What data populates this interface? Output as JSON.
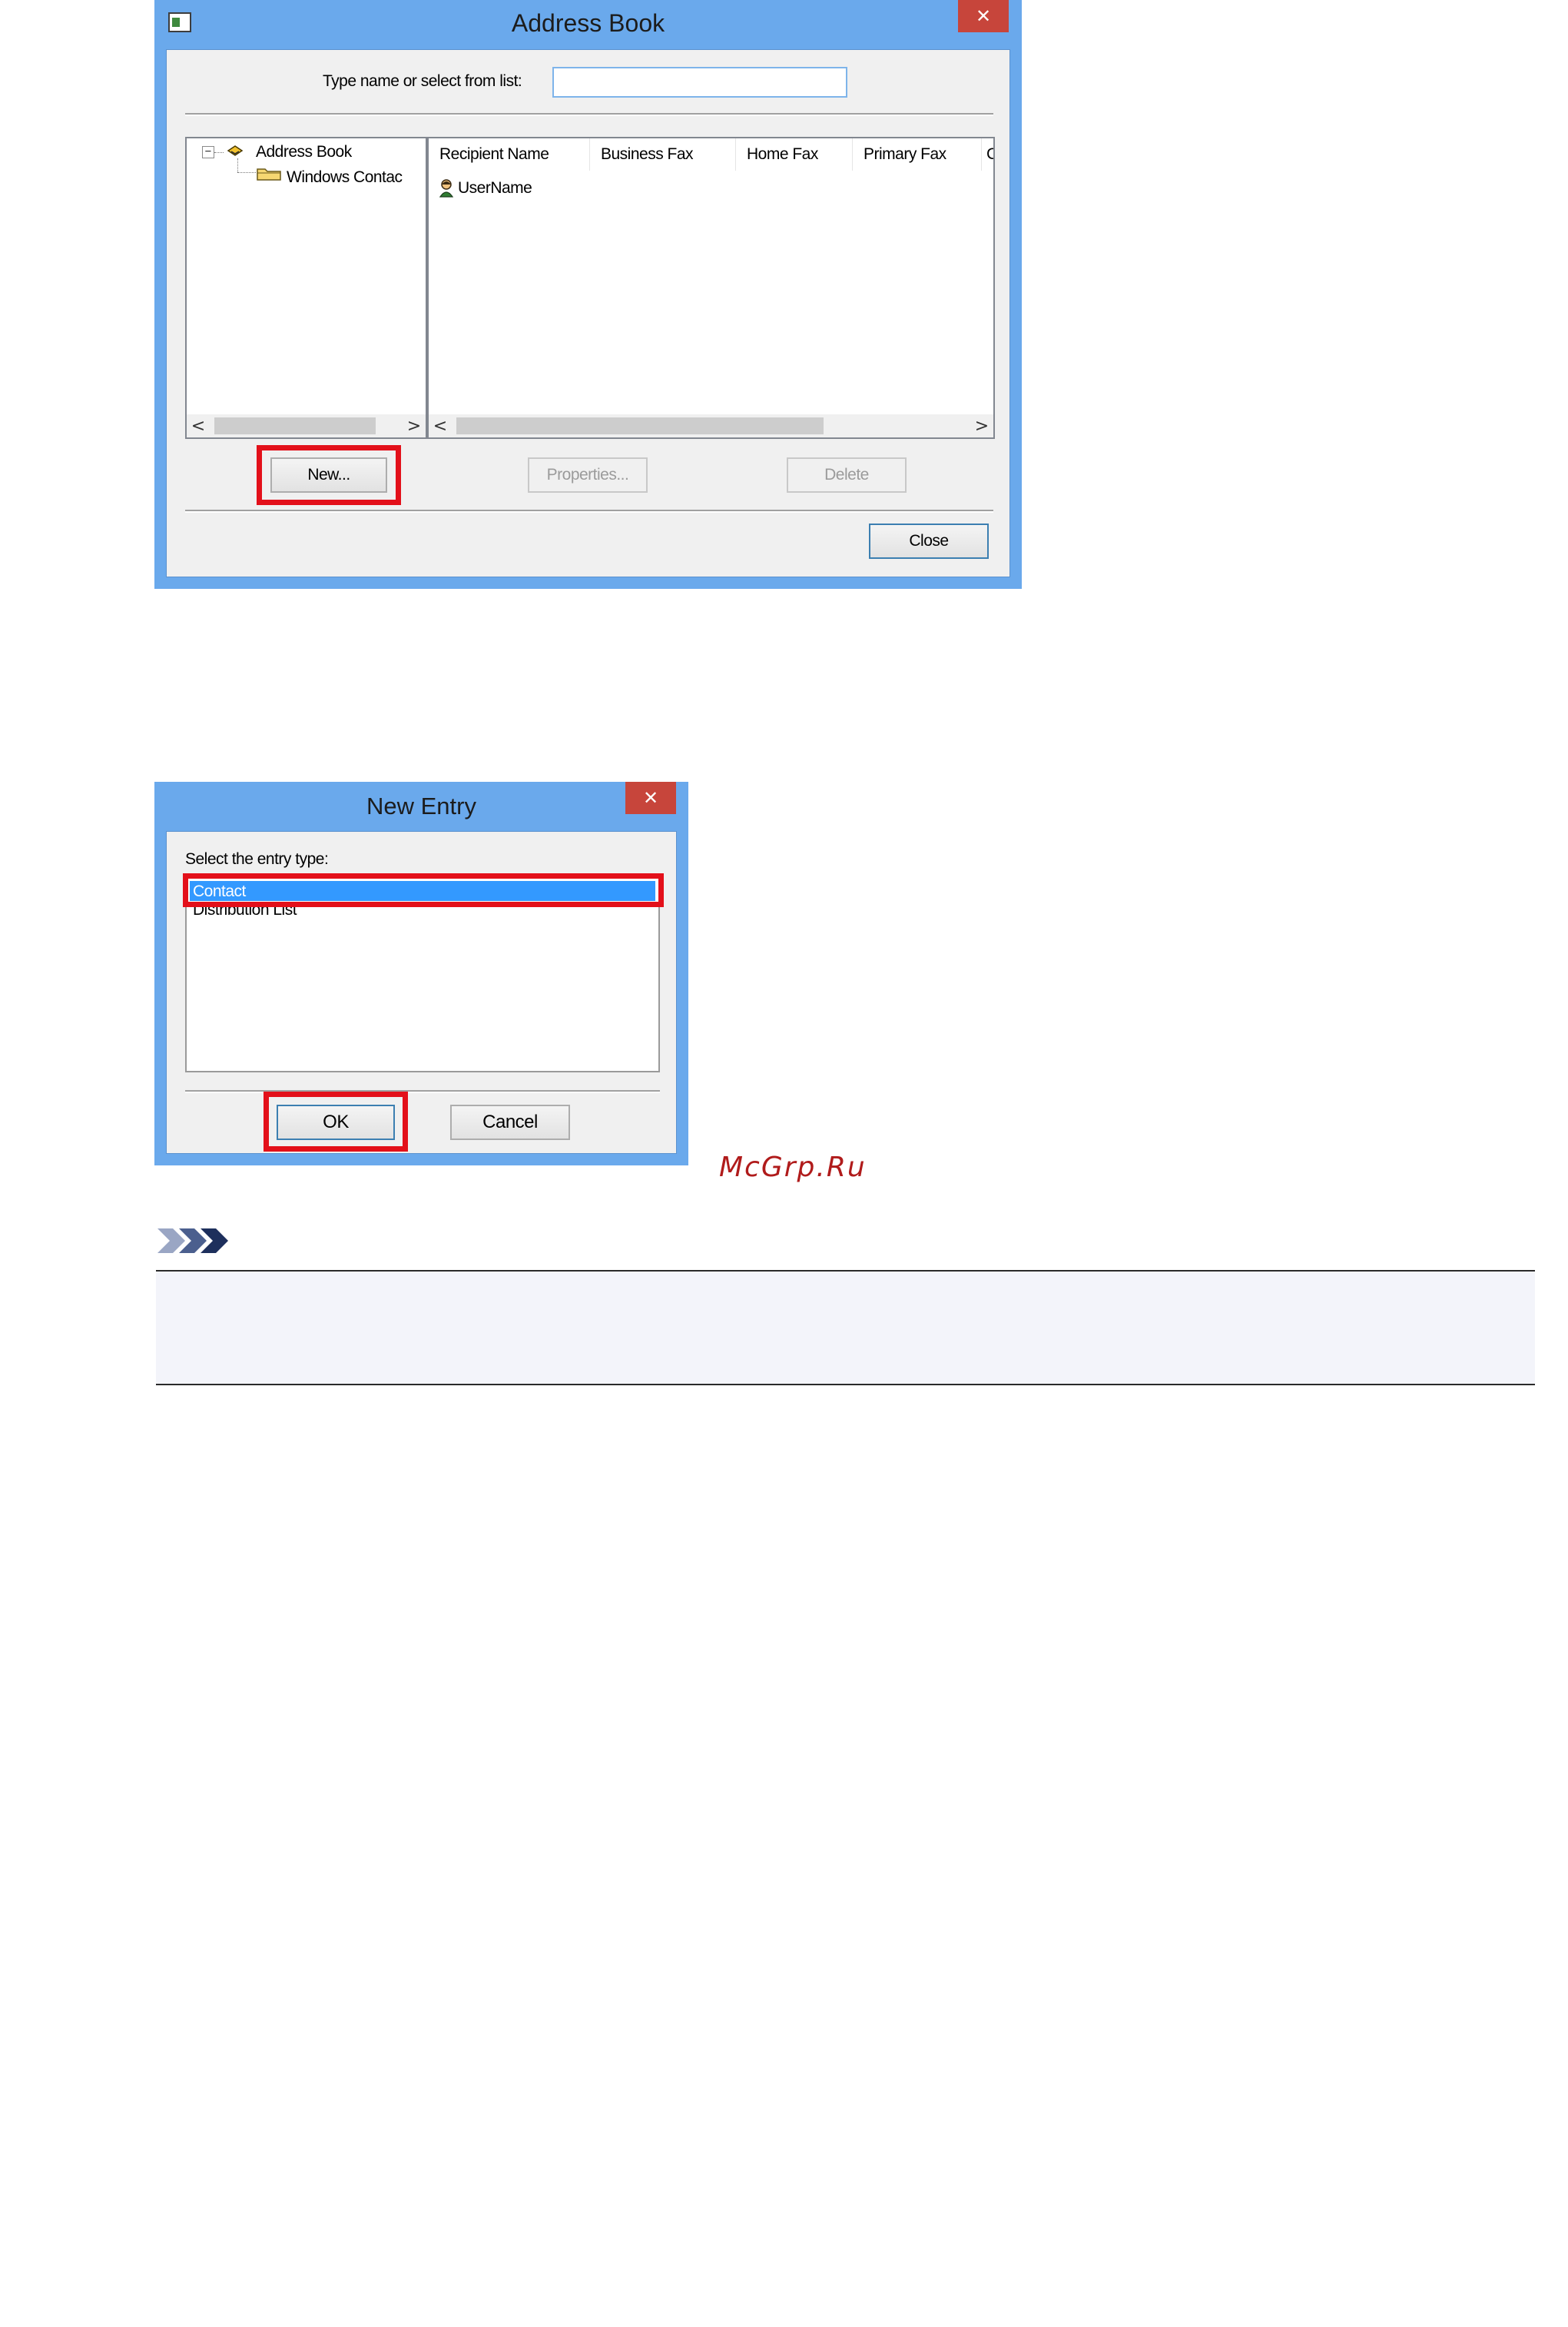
{
  "address_book": {
    "title": "Address Book",
    "close_x": "✕",
    "type_label": "Type name or select from list:",
    "input_value": "",
    "tree": {
      "root_label": "Address Book",
      "child_label": "Windows Contac"
    },
    "columns": [
      "Recipient Name",
      "Business Fax",
      "Home Fax",
      "Primary Fax",
      "C"
    ],
    "rows": [
      {
        "name": "UserName"
      }
    ],
    "buttons": {
      "new": "New...",
      "properties": "Properties...",
      "delete": "Delete",
      "close": "Close"
    },
    "scroll_left": "<",
    "scroll_right": ">"
  },
  "new_entry": {
    "title": "New Entry",
    "close_x": "✕",
    "prompt": "Select the entry type:",
    "items": [
      "Contact",
      "Distribution List"
    ],
    "selected_index": 0,
    "buttons": {
      "ok": "OK",
      "cancel": "Cancel"
    }
  },
  "watermark": "McGrp.Ru",
  "colors": {
    "titlebar": "#6aa9ec",
    "close": "#c7453b",
    "highlight": "#e3101a",
    "selection": "#3399ff",
    "note_bg": "#f3f4fa",
    "watermark": "#b01b1b",
    "note_icon": "#1d2f5c"
  },
  "note_icon": "double-chevron-icon"
}
